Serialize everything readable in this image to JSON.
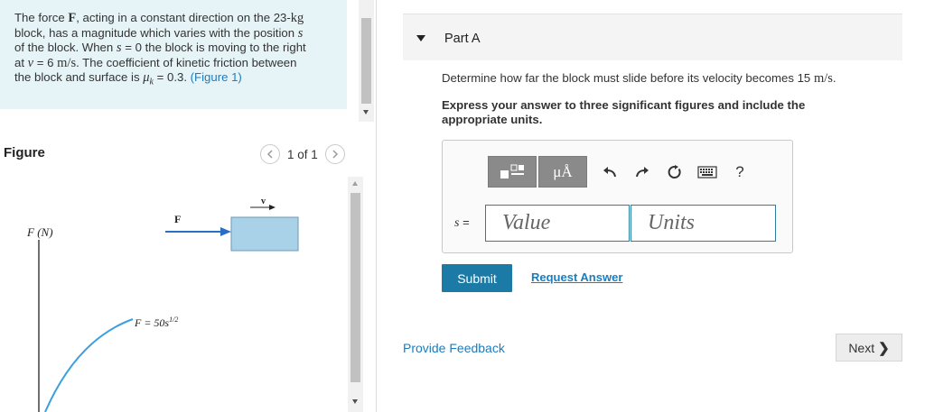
{
  "problem": {
    "text1": "The force ",
    "bold_F": "F",
    "text2": ", acting in a constant direction on the 23-",
    "unit_kg": "kg",
    "text3": "block, has a magnitude which varies with the position ",
    "var_s": "s",
    "text4": "of the block. When ",
    "s_eq": "s",
    "text5": " = 0 the block is moving to the right",
    "text6": "at ",
    "v_eq": "v",
    "text7": " = 6 ",
    "unit_ms": "m/s",
    "text8": ". The coefficient of kinetic friction between",
    "text9": "the block and surface is ",
    "mu": "μ",
    "mu_sub": "k",
    "text10": " = 0.3. ",
    "figure_link": "(Figure 1)"
  },
  "figure_panel": {
    "label": "Figure",
    "pager_text": "1 of 1",
    "prev_icon": "chevron-left",
    "next_icon": "chevron-right",
    "axis_label": "F (N)",
    "force_label": "F",
    "velocity_label": "v",
    "equation": "F = 50s",
    "exponent": "1/2"
  },
  "part": {
    "title": "Part A",
    "question_prefix": "Determine how far the block must slide before its velocity becomes 15 ",
    "question_unit": "m/s",
    "question_suffix": ".",
    "instruction": "Express your answer to three significant figures and include the appropriate units."
  },
  "answer": {
    "variable": "s",
    "equals": " =",
    "value_placeholder": "Value",
    "units_placeholder": "Units",
    "toolbar": {
      "units_btn": "μÅ",
      "help": "?"
    },
    "submit_label": "Submit",
    "request_label": "Request Answer"
  },
  "footer": {
    "feedback": "Provide Feedback",
    "next_label": "Next",
    "next_chevron": "❯"
  },
  "colors": {
    "problem_bg": "#e6f4f7",
    "accent": "#1c7ba6",
    "link": "#1a7dbf",
    "curve": "#3aa0e0",
    "block": "#a9d2e8"
  }
}
